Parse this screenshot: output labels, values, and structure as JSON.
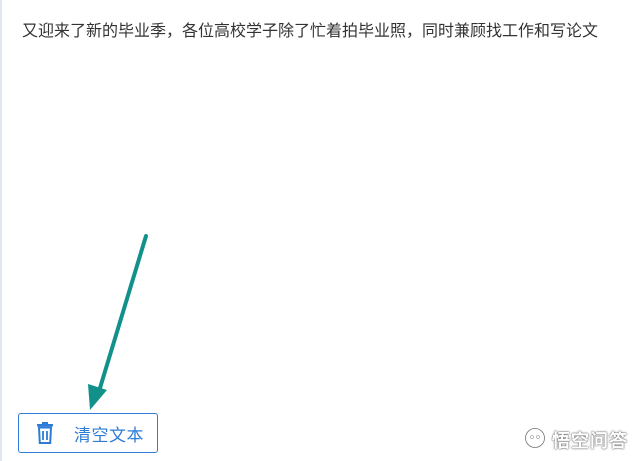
{
  "editor": {
    "text": "又迎来了新的毕业季，各位高校学子除了忙着拍毕业照，同时兼顾找工作和写论文"
  },
  "toolbar": {
    "clear_label": "清空文本",
    "clear_icon": "trash-icon"
  },
  "annotation": {
    "arrow_color": "#12918a"
  },
  "watermark": {
    "text": "悟空问答",
    "icon": "wukong-logo-icon"
  },
  "colors": {
    "accent": "#2e7cd6",
    "text": "#333333"
  }
}
